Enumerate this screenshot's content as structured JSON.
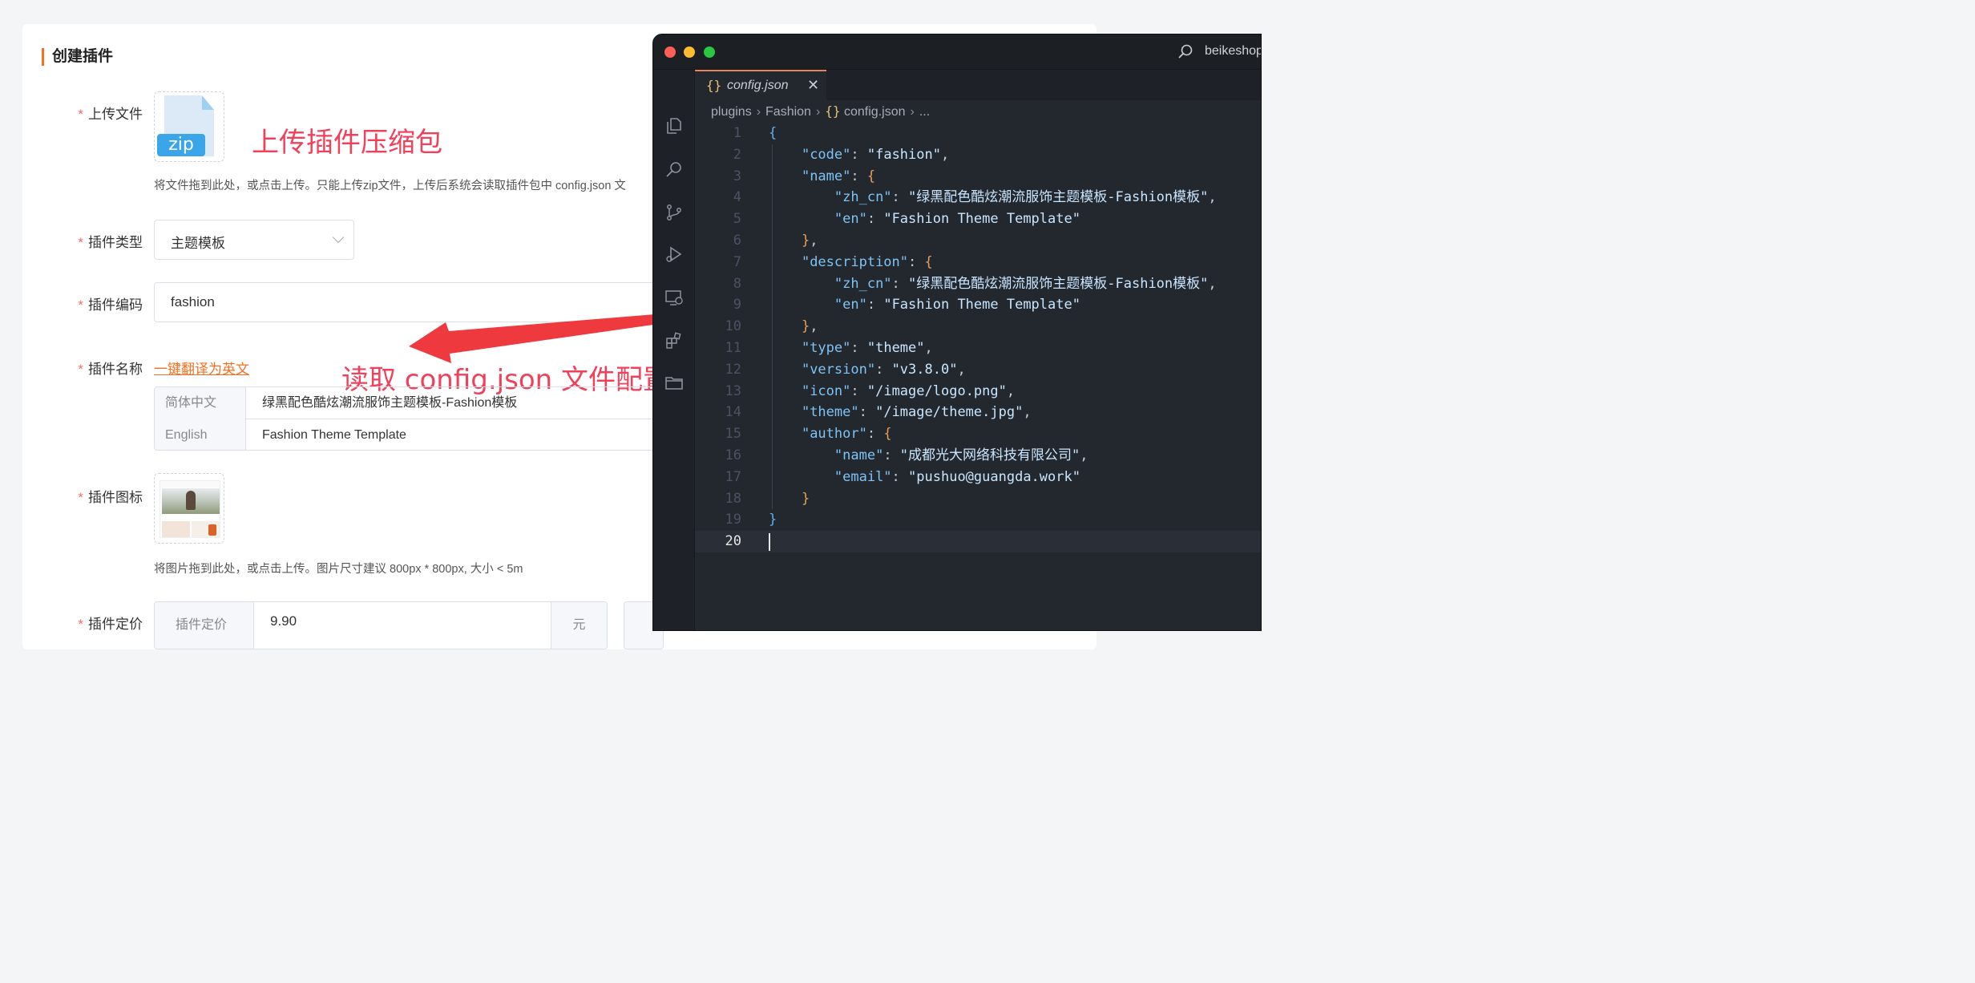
{
  "form": {
    "title": "创建插件",
    "required_mark": "*",
    "upload_file": {
      "label": "上传文件",
      "file_tag": "zip",
      "annotation": "上传插件压缩包",
      "hint": "将文件拖到此处，或点击上传。只能上传zip文件，上传后系统会读取插件包中 config.json 文"
    },
    "plugin_type": {
      "label": "插件类型",
      "value": "主题模板"
    },
    "plugin_code": {
      "label": "插件编码",
      "value": "fashion"
    },
    "plugin_name": {
      "label": "插件名称",
      "translate_link": "一键翻译为英文",
      "annotation": "读取 config.json 文件配置",
      "rows": [
        {
          "lang": "简体中文",
          "value": "绿黑配色酷炫潮流服饰主题模板-Fashion模板"
        },
        {
          "lang": "English",
          "value": "Fashion Theme Template"
        }
      ]
    },
    "plugin_icon": {
      "label": "插件图标",
      "hint": "将图片拖到此处，或点击上传。图片尺寸建议 800px * 800px, 大小 < 5m"
    },
    "plugin_price": {
      "label": "插件定价",
      "prefix": "插件定价",
      "value": "9.90",
      "unit": "元"
    }
  },
  "editor": {
    "window_title": "beikeshop",
    "tab": {
      "icon": "{}",
      "name": "config.json",
      "close": "✕"
    },
    "breadcrumb": [
      "plugins",
      "Fashion",
      "config.json",
      "..."
    ],
    "active_line": 20,
    "lines": [
      "{",
      "    \"code\": \"fashion\",",
      "    \"name\": {",
      "        \"zh_cn\": \"绿黑配色酷炫潮流服饰主题模板-Fashion模板\",",
      "        \"en\": \"Fashion Theme Template\"",
      "    },",
      "    \"description\": {",
      "        \"zh_cn\": \"绿黑配色酷炫潮流服饰主题模板-Fashion模板\",",
      "        \"en\": \"Fashion Theme Template\"",
      "    },",
      "    \"type\": \"theme\",",
      "    \"version\": \"v3.8.0\",",
      "    \"icon\": \"/image/logo.png\",",
      "    \"theme\": \"/image/theme.jpg\",",
      "    \"author\": {",
      "        \"name\": \"成都光大网络科技有限公司\",",
      "        \"email\": \"pushuo@guangda.work\"",
      "    }",
      "}",
      ""
    ]
  },
  "icons": {
    "activity_bar": [
      "files-icon",
      "search-icon",
      "source-control-icon",
      "run-debug-icon",
      "remote-explorer-icon",
      "extensions-icon",
      "folder-icon"
    ]
  },
  "colors": {
    "accent": "#f37021",
    "required": "#f56c6c",
    "annotation": "#f0405a",
    "arrow": "#ee3a3f",
    "editor_bg": "#23272e"
  }
}
